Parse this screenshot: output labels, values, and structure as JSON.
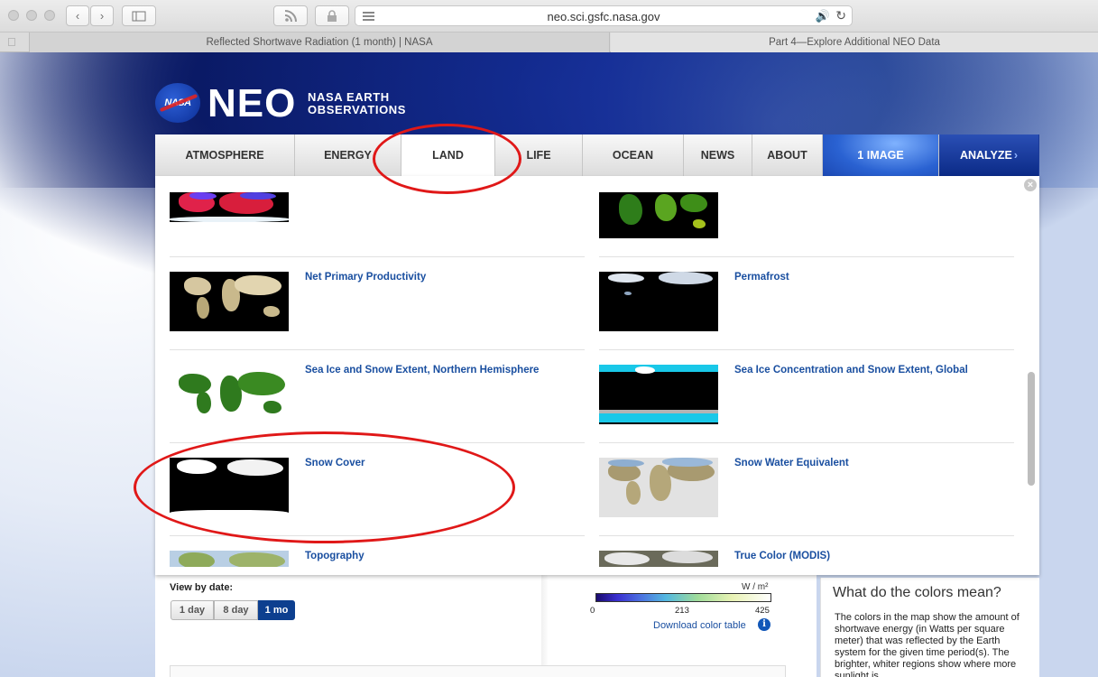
{
  "browser": {
    "url": "neo.sci.gsfc.nasa.gov",
    "tabs": [
      {
        "label": "Reflected Shortwave Radiation (1 month) | NASA",
        "active": true
      },
      {
        "label": "Part 4—Explore Additional NEO Data",
        "active": false
      }
    ]
  },
  "header": {
    "nasa_badge": "NASA",
    "neo": "NEO",
    "subtitle_line1": "NASA EARTH",
    "subtitle_line2": "OBSERVATIONS"
  },
  "nav": {
    "items": [
      {
        "label": "ATMOSPHERE"
      },
      {
        "label": "ENERGY"
      },
      {
        "label": "LAND",
        "active": true
      },
      {
        "label": "LIFE"
      },
      {
        "label": "OCEAN"
      },
      {
        "label": "NEWS"
      },
      {
        "label": "ABOUT"
      },
      {
        "label": "1 IMAGE"
      },
      {
        "label": "ANALYZE"
      }
    ]
  },
  "panel": {
    "items": [
      {
        "title": ""
      },
      {
        "title": ""
      },
      {
        "title": "Net Primary Productivity"
      },
      {
        "title": "Permafrost"
      },
      {
        "title": "Sea Ice and Snow Extent, Northern Hemisphere"
      },
      {
        "title": "Sea Ice Concentration and Snow Extent, Global"
      },
      {
        "title": "Snow Cover"
      },
      {
        "title": "Snow Water Equivalent"
      },
      {
        "title": "Topography"
      },
      {
        "title": "True Color (MODIS)"
      }
    ]
  },
  "view_by_date": {
    "label": "View by date:",
    "options": [
      "1 day",
      "8 day",
      "1 mo"
    ],
    "selected": "1 mo"
  },
  "color_scale": {
    "unit": "W / m²",
    "ticks": [
      "0",
      "213",
      "425"
    ],
    "download_link": "Download color table",
    "info_icon": "i"
  },
  "colors_meaning": {
    "title": "What do the colors mean?",
    "text": "The colors in the map show the amount of shortwave energy (in Watts per square meter) that was reflected by the Earth system for the given time period(s). The brighter, whiter regions show where more sunlight is"
  },
  "accent_colors": {
    "link_blue": "#1a4fa0",
    "annotation_red": "#e01818",
    "selected_blue": "#0d3f8f"
  }
}
